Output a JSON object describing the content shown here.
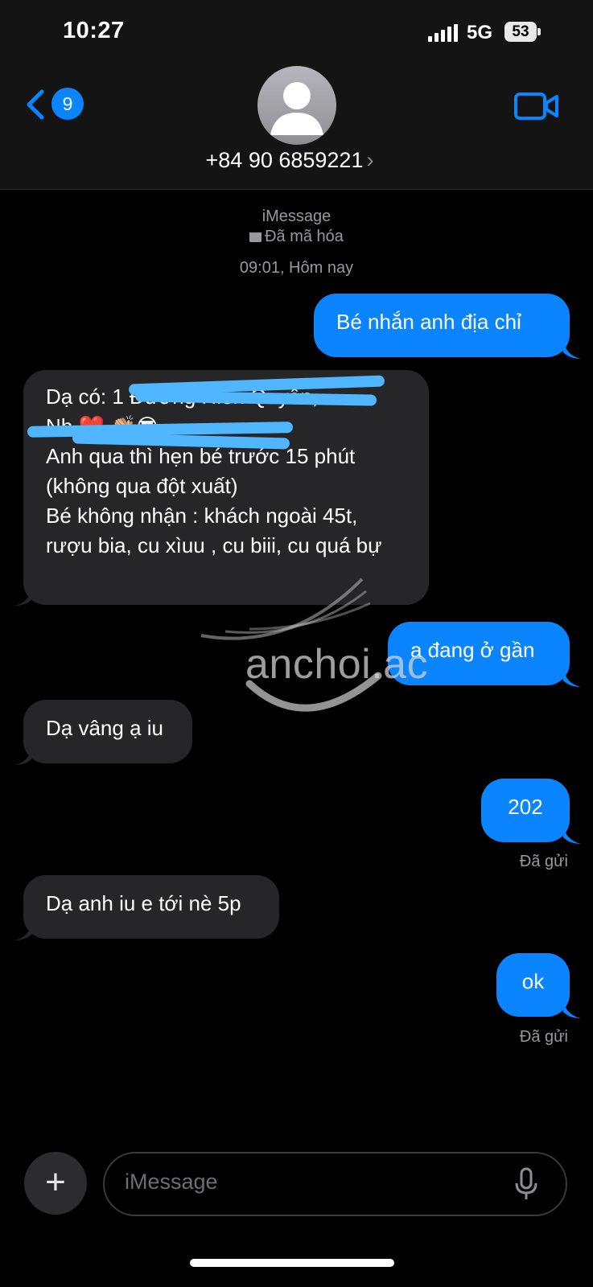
{
  "status_bar": {
    "time": "10:27",
    "network": "5G",
    "battery": "53"
  },
  "header": {
    "back_badge": "9",
    "contact_name": "+84 90 6859221",
    "icons": [
      "chevron-left-icon",
      "person-icon",
      "video-camera-icon",
      "chevron-right-icon"
    ]
  },
  "conversation": {
    "service": "iMessage",
    "encryption": "Đã mã hóa",
    "timestamp": "09:01, Hôm nay"
  },
  "messages": [
    {
      "dir": "out",
      "text": "Bé nhắn anh địa chỉ"
    },
    {
      "dir": "in",
      "lines": [
        "Dạ có: 1 Đường Hiền Quyên,",
        "Nh ❤️ 👏🏼😎",
        "Anh qua thì hẹn bé trước 15 phút",
        "(không qua đột xuất)",
        "Bé không nhận : khách ngoài 45t,",
        "rượu bia, cu xìuu , cu biii, cu quá bự"
      ]
    },
    {
      "dir": "out",
      "text": "a đang ở gần"
    },
    {
      "dir": "in",
      "text": "Dạ vâng ạ iu"
    },
    {
      "dir": "out",
      "text": "202",
      "status": "Đã gửi"
    },
    {
      "dir": "in",
      "text": "Dạ anh iu e tới nè 5p"
    },
    {
      "dir": "out",
      "text": "ok",
      "status": "Đã gửi"
    }
  ],
  "watermark": "anchoi.ac",
  "input": {
    "placeholder": "iMessage"
  },
  "colors": {
    "outgoing": "#0a84ff",
    "incoming": "#262628",
    "background": "#000000"
  }
}
